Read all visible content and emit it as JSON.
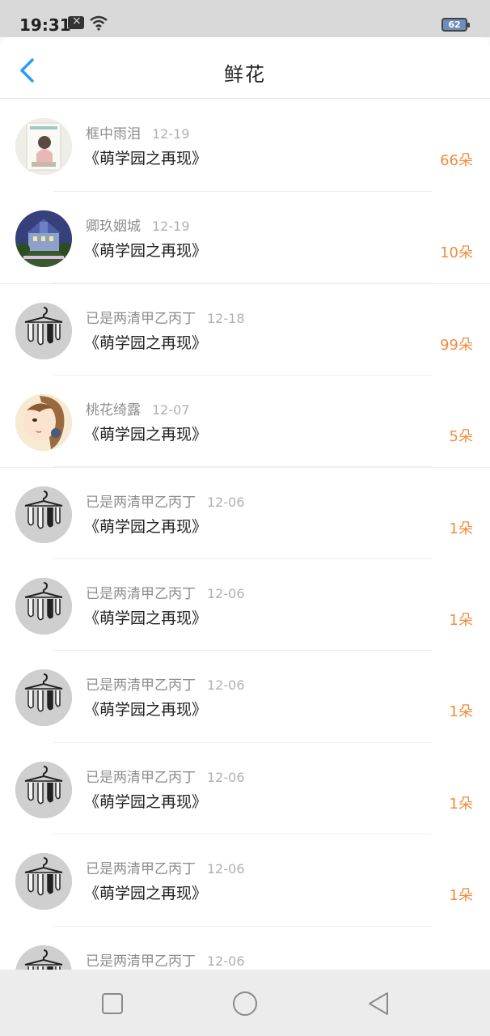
{
  "status_bar": {
    "time": "19:31",
    "battery": "62"
  },
  "header": {
    "title": "鲜花"
  },
  "items": [
    {
      "name": "框中雨泪",
      "date": "12-19",
      "book": "《萌学园之再现》",
      "count": "66朵",
      "avatar": "girl-sketch",
      "group_start": false
    },
    {
      "name": "卿玖姻城",
      "date": "12-19",
      "book": "《萌学园之再现》",
      "count": "10朵",
      "avatar": "castle",
      "group_start": false
    },
    {
      "name": "已是两清甲乙丙丁",
      "date": "12-18",
      "book": "《萌学园之再现》",
      "count": "99朵",
      "avatar": "hanger",
      "group_start": true
    },
    {
      "name": "桃花绮露",
      "date": "12-07",
      "book": "《萌学园之再现》",
      "count": "5朵",
      "avatar": "anime-girl",
      "group_start": false
    },
    {
      "name": "已是两清甲乙丙丁",
      "date": "12-06",
      "book": "《萌学园之再现》",
      "count": "1朵",
      "avatar": "hanger",
      "group_start": true
    },
    {
      "name": "已是两清甲乙丙丁",
      "date": "12-06",
      "book": "《萌学园之再现》",
      "count": "1朵",
      "avatar": "hanger",
      "group_start": false
    },
    {
      "name": "已是两清甲乙丙丁",
      "date": "12-06",
      "book": "《萌学园之再现》",
      "count": "1朵",
      "avatar": "hanger",
      "group_start": false
    },
    {
      "name": "已是两清甲乙丙丁",
      "date": "12-06",
      "book": "《萌学园之再现》",
      "count": "1朵",
      "avatar": "hanger",
      "group_start": false
    },
    {
      "name": "已是两清甲乙丙丁",
      "date": "12-06",
      "book": "《萌学园之再现》",
      "count": "1朵",
      "avatar": "hanger",
      "group_start": false
    },
    {
      "name": "已是两清甲乙丙丁",
      "date": "12-06",
      "book": "",
      "count": "",
      "avatar": "hanger",
      "group_start": false
    }
  ],
  "colors": {
    "accent": "#2a9df4",
    "count": "#f08c3e",
    "name": "#8e8e8e"
  },
  "icons": {
    "back": "chevron-left-icon",
    "recent": "square-icon",
    "home": "circle-icon",
    "nav_back": "triangle-left-icon"
  }
}
